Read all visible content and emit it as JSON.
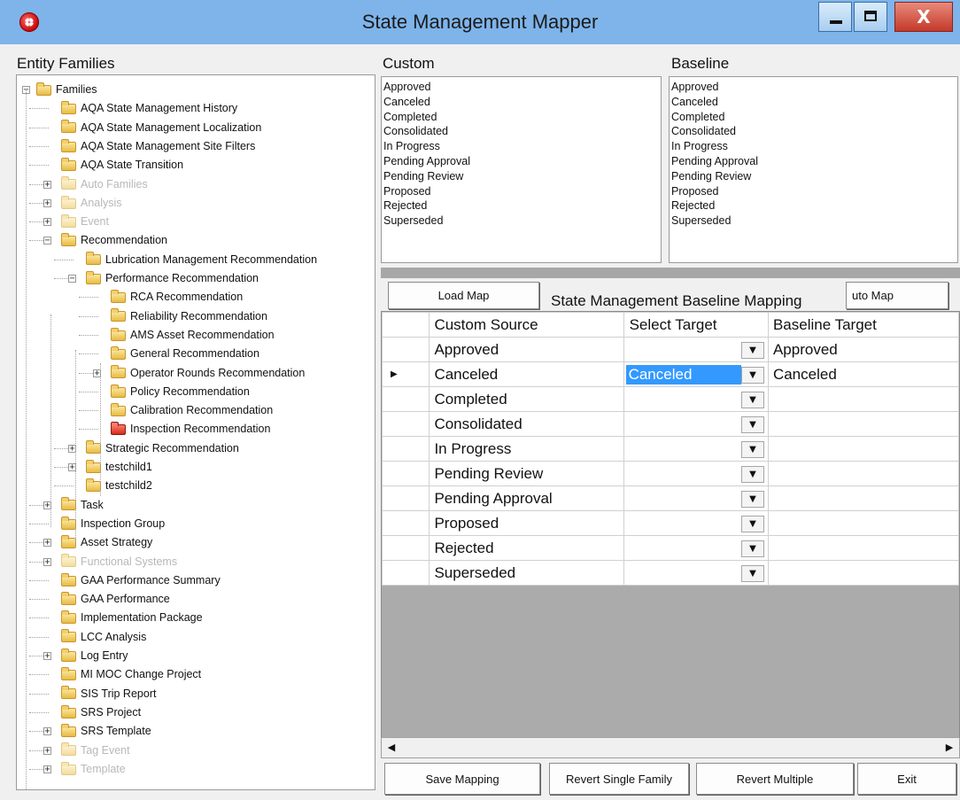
{
  "window": {
    "title": "State Management Mapper",
    "minimize_glyph": "",
    "maximize_glyph": "",
    "close_glyph": "X"
  },
  "entity_families": {
    "label": "Entity Families",
    "nodes": [
      {
        "label": "Families"
      },
      {
        "label": "AQA State Management History"
      },
      {
        "label": "AQA State Management Localization"
      },
      {
        "label": "AQA State Management Site Filters"
      },
      {
        "label": "AQA State Transition"
      },
      {
        "label": "Auto Families"
      },
      {
        "label": "Analysis"
      },
      {
        "label": "Event"
      },
      {
        "label": "Recommendation"
      },
      {
        "label": "Lubrication Management Recommendation"
      },
      {
        "label": "Performance Recommendation"
      },
      {
        "label": "RCA Recommendation"
      },
      {
        "label": "Reliability Recommendation"
      },
      {
        "label": "AMS Asset Recommendation"
      },
      {
        "label": "General Recommendation"
      },
      {
        "label": "Operator Rounds Recommendation"
      },
      {
        "label": "Policy Recommendation"
      },
      {
        "label": "Calibration Recommendation"
      },
      {
        "label": "Inspection Recommendation"
      },
      {
        "label": "Strategic Recommendation"
      },
      {
        "label": "testchild1"
      },
      {
        "label": "testchild2"
      },
      {
        "label": "Task"
      },
      {
        "label": "Inspection Group"
      },
      {
        "label": "Asset Strategy"
      },
      {
        "label": "Functional Systems"
      },
      {
        "label": "GAA Performance Summary"
      },
      {
        "label": "GAA Performance"
      },
      {
        "label": "Implementation Package"
      },
      {
        "label": "LCC Analysis"
      },
      {
        "label": "Log Entry"
      },
      {
        "label": "MI MOC Change Project"
      },
      {
        "label": "SIS Trip Report"
      },
      {
        "label": "SRS Project"
      },
      {
        "label": "SRS Template"
      },
      {
        "label": "Tag Event"
      },
      {
        "label": "Template"
      }
    ]
  },
  "custom": {
    "label": "Custom",
    "items": [
      "Approved",
      "Canceled",
      "Completed",
      "Consolidated",
      "In Progress",
      "Pending Approval",
      "Pending Review",
      "Proposed",
      "Rejected",
      "Superseded"
    ]
  },
  "baseline": {
    "label": "Baseline",
    "items": [
      "Approved",
      "Canceled",
      "Completed",
      "Consolidated",
      "In Progress",
      "Pending Approval",
      "Pending Review",
      "Proposed",
      "Rejected",
      "Superseded"
    ]
  },
  "mapping": {
    "load_map_label": "Load Map",
    "title": "State Management Baseline Mapping",
    "auto_map_label": "uto Map",
    "columns": [
      "Custom Source",
      "Select Target",
      "Baseline Target"
    ],
    "rows": [
      {
        "source": "Approved",
        "target": "",
        "baseline": "Approved"
      },
      {
        "source": "Canceled",
        "target": "Canceled",
        "baseline": "Canceled"
      },
      {
        "source": "Completed",
        "target": "",
        "baseline": ""
      },
      {
        "source": "Consolidated",
        "target": "",
        "baseline": ""
      },
      {
        "source": "In Progress",
        "target": "",
        "baseline": ""
      },
      {
        "source": "Pending Review",
        "target": "",
        "baseline": ""
      },
      {
        "source": "Pending Approval",
        "target": "",
        "baseline": ""
      },
      {
        "source": "Proposed",
        "target": "",
        "baseline": ""
      },
      {
        "source": "Rejected",
        "target": "",
        "baseline": ""
      },
      {
        "source": "Superseded",
        "target": "",
        "baseline": ""
      }
    ]
  },
  "footer": {
    "save_label": "Save Mapping",
    "revert_single_label": "Revert Single Family",
    "revert_multiple_label": "Revert Multiple",
    "exit_label": "Exit"
  }
}
